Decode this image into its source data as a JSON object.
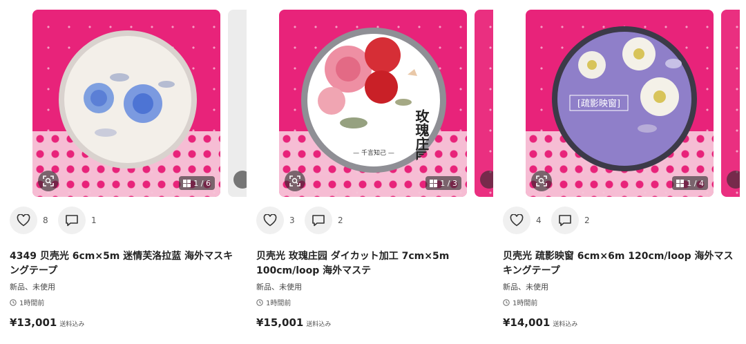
{
  "listings": [
    {
      "title": "4349 贝壳光 6cm×5m 迷情芙洛拉蓝 海外マスキングテープ",
      "likes": "8",
      "comments": "1",
      "image_counter": "1 / 6",
      "condition": "新品、未使用",
      "posted": "1時間前",
      "price": "¥13,001",
      "shipping": "送料込み"
    },
    {
      "title": "贝壳光 玫瑰庄园 ダイカット加工 7cm×5m 100cm/loop 海外マステ",
      "likes": "3",
      "comments": "2",
      "image_counter": "1 / 3",
      "tape_label": "玫瑰庄园",
      "tape_sub": "— 千言知己 —",
      "condition": "新品、未使用",
      "posted": "1時間前",
      "price": "¥15,001",
      "shipping": "送料込み"
    },
    {
      "title": "贝壳光 疏影映窗 6cm×6m 120cm/loop 海外マスキングテープ",
      "likes": "4",
      "comments": "2",
      "image_counter": "1 / 4",
      "tape_label": "[疏影映窗]",
      "condition": "新品、未使用",
      "posted": "1時間前",
      "price": "¥14,001",
      "shipping": "送料込み"
    }
  ],
  "colors": {
    "photo_bg": "#e8237a",
    "text": "#222222",
    "button_bg": "#f0f0f0"
  },
  "icons": [
    "heart-icon",
    "comment-icon",
    "scan-icon",
    "gallery-icon",
    "clock-icon"
  ]
}
